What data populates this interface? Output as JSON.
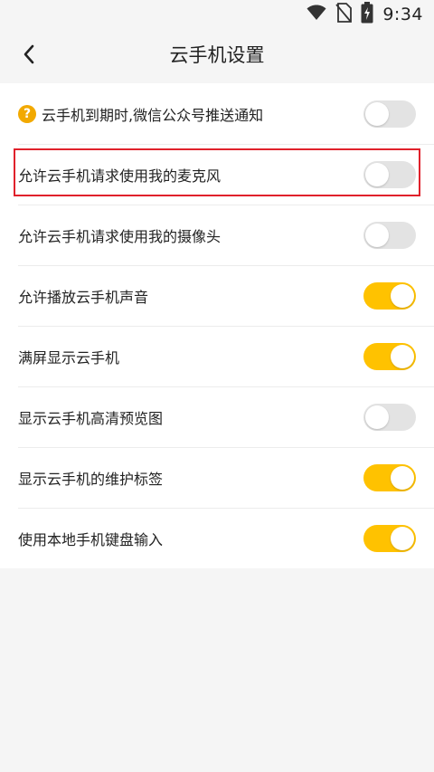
{
  "status_bar": {
    "time": "9:34",
    "icons": [
      "wifi-icon",
      "no-sim-icon",
      "battery-charging-icon"
    ]
  },
  "header": {
    "back_icon": "chevron-left-icon",
    "title": "云手机设置"
  },
  "settings": [
    {
      "label": "云手机到期时,微信公众号推送通知",
      "has_help_icon": true,
      "help_icon_text": "?",
      "enabled": false
    },
    {
      "label": "允许云手机请求使用我的麦克风",
      "enabled": false,
      "highlighted": true
    },
    {
      "label": "允许云手机请求使用我的摄像头",
      "enabled": false
    },
    {
      "label": "允许播放云手机声音",
      "enabled": true
    },
    {
      "label": "满屏显示云手机",
      "enabled": true
    },
    {
      "label": "显示云手机高清预览图",
      "enabled": false
    },
    {
      "label": "显示云手机的维护标签",
      "enabled": true
    },
    {
      "label": "使用本地手机键盘输入",
      "enabled": true
    }
  ],
  "colors": {
    "toggle_on": "#ffc200",
    "toggle_off": "#e3e3e3",
    "help_icon": "#f2a900",
    "highlight_border": "#e0212b",
    "background": "#f5f5f5"
  }
}
